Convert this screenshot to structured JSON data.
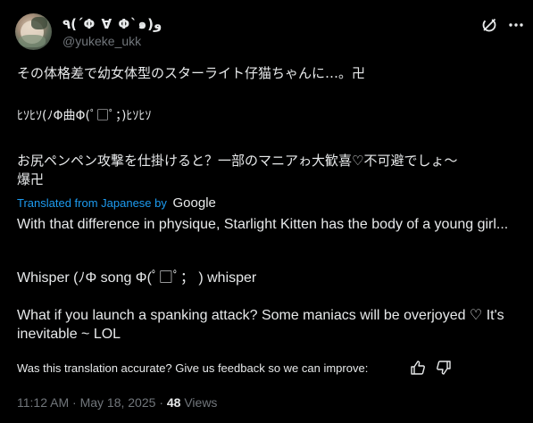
{
  "author": {
    "display_name": "٩(´Φ ∀ Φ`๑)و",
    "handle": "@yukeke_ukk"
  },
  "post": {
    "original_lines": [
      "その体格差で幼女体型のスターライト仔猫ちゃんに…。卍",
      "ﾋｿﾋｿ(ﾉΦ曲Φ(ﾟ□ﾟ；)ﾋｿﾋｿ",
      "お尻ペンペン攻撃を仕掛けると？一部のマニアゎ大歓喜♡不可避でしょ〜",
      "爆卍"
    ],
    "translated_from": "Translated from Japanese by",
    "translator": "Google",
    "translation_lines": [
      "With that difference in physique, Starlight Kitten has the body of a young girl...",
      "Whisper (ﾉΦ song Φ(ﾟ□ﾟ； ) whisper",
      "What if you launch a spanking attack? Some maniacs will be overjoyed ♡ It's inevitable ~ LOL"
    ]
  },
  "feedback": {
    "prompt": "Was this translation accurate? Give us feedback so we can improve:"
  },
  "meta": {
    "time": "11:12 AM",
    "separator": "·",
    "date": "May 18, 2025",
    "views_count": "48",
    "views_label": "Views"
  },
  "icons": {
    "grok": "grok-icon",
    "more": "more-icon",
    "thumb_up": "thumbs-up-icon",
    "thumb_down": "thumbs-down-icon"
  },
  "colors": {
    "background": "#000000",
    "text": "#e7e9ea",
    "secondary": "#71767b",
    "link": "#1d9bf0"
  }
}
